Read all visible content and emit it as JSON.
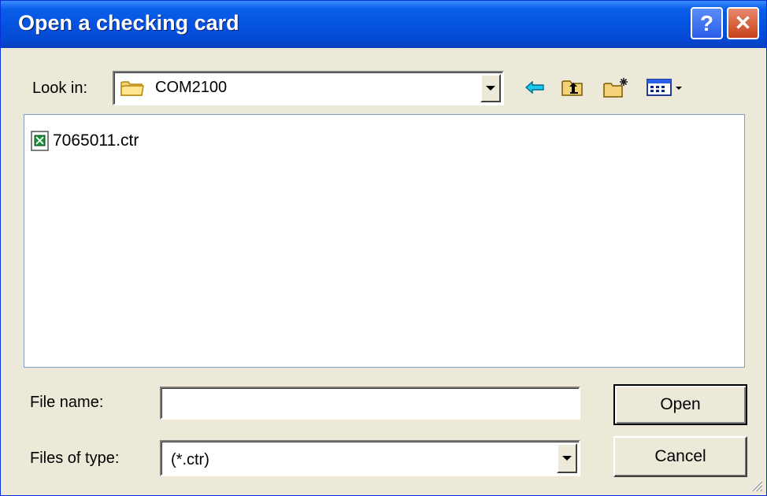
{
  "dialog": {
    "title": "Open a checking card",
    "help_label": "?",
    "close_label": "✕"
  },
  "lookin": {
    "label": "Look in:",
    "value": "COM2100",
    "folder_icon": "folder-icon"
  },
  "toolbar": {
    "back_icon": "back-arrow-icon",
    "up_icon": "up-one-level-icon",
    "new_folder_icon": "new-folder-icon",
    "view_menu_icon": "view-menu-icon"
  },
  "files": [
    {
      "name": "7065011.ctr",
      "icon": "ctr-file-icon"
    }
  ],
  "filename": {
    "label": "File name:",
    "value": ""
  },
  "filetype": {
    "label": "Files of type:",
    "value": "(*.ctr)"
  },
  "buttons": {
    "open_label": "Open",
    "cancel_label": "Cancel"
  },
  "colors": {
    "titlebar": "#0553e1",
    "dialog_bg": "#ece9d8",
    "close_button": "#c8411b",
    "back_arrow": "#00b4d8"
  }
}
